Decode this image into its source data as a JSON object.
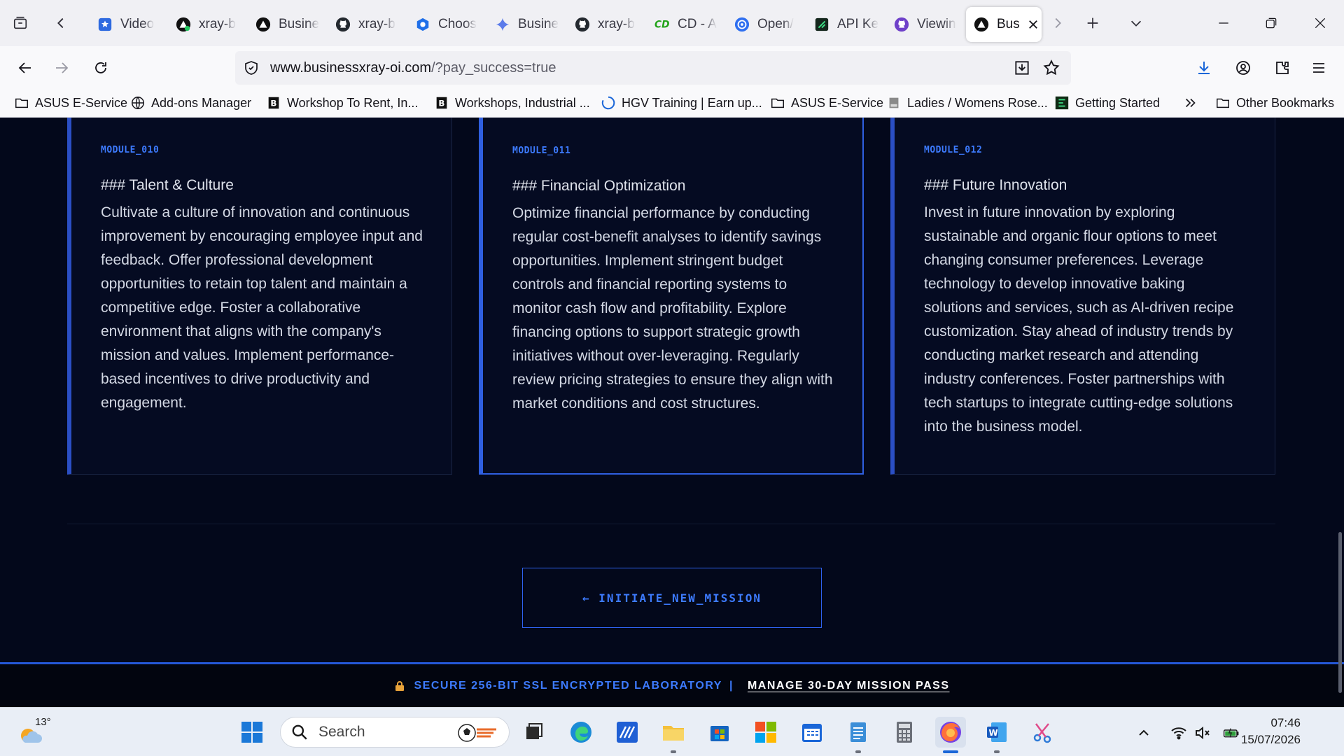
{
  "browser": {
    "tabs": [
      {
        "label": "Video",
        "icon": "gear-star-icon",
        "active": false
      },
      {
        "label": "xray-b",
        "icon": "triangle-logo-icon",
        "active": false
      },
      {
        "label": "Busine",
        "icon": "triangle-logo-icon",
        "active": false
      },
      {
        "label": "xray-b",
        "icon": "github-icon",
        "active": false
      },
      {
        "label": "Choos",
        "icon": "hexagon-icon",
        "active": false
      },
      {
        "label": "Busine",
        "icon": "sparkle-icon",
        "active": false
      },
      {
        "label": "xray-b",
        "icon": "github-icon",
        "active": false
      },
      {
        "label": "CD - A",
        "icon": "cd-logo-icon",
        "active": false
      },
      {
        "label": "Open/",
        "icon": "openai-icon",
        "active": false
      },
      {
        "label": "API Ke",
        "icon": "api-key-icon",
        "active": false
      },
      {
        "label": "Viewin",
        "icon": "github-purple-icon",
        "active": false
      },
      {
        "label": "Bus",
        "icon": "triangle-logo-icon",
        "active": true
      }
    ],
    "url_host": "www.businessxray-oi.com",
    "url_path": "/?pay_success=true",
    "bookmarks": [
      {
        "label": "ASUS E-Service",
        "icon": "folder-icon"
      },
      {
        "label": "Add-ons Manager",
        "icon": "globe-icon"
      },
      {
        "label": "Workshop To Rent, In...",
        "icon": "b-logo-icon"
      },
      {
        "label": "Workshops, Industrial ...",
        "icon": "b-logo-icon"
      },
      {
        "label": "HGV Training | Earn up...",
        "icon": "loading-ring-icon"
      },
      {
        "label": "ASUS E-Service",
        "icon": "folder-icon"
      },
      {
        "label": "Ladies / Womens Rose...",
        "icon": "shoe-icon"
      },
      {
        "label": "Getting Started",
        "icon": "green-logo-icon"
      },
      {
        "label": "Other Bookmarks",
        "icon": "folder-icon"
      }
    ]
  },
  "page": {
    "cards": [
      {
        "module": "MODULE_010",
        "title": "### Talent & Culture",
        "body": "Cultivate a culture of innovation and continuous improvement by encouraging employee input and feedback. Offer professional development opportunities to retain top talent and maintain a competitive edge. Foster a collaborative environment that aligns with the company's mission and values. Implement performance-based incentives to drive productivity and engagement."
      },
      {
        "module": "MODULE_011",
        "title": "### Financial Optimization",
        "body": "Optimize financial performance by conducting regular cost-benefit analyses to identify savings opportunities. Implement stringent budget controls and financial reporting systems to monitor cash flow and profitability. Explore financing options to support strategic growth initiatives without over-leveraging. Regularly review pricing strategies to ensure they align with market conditions and cost structures."
      },
      {
        "module": "MODULE_012",
        "title": "### Future Innovation",
        "body": "Invest in future innovation by exploring sustainable and organic flour options to meet changing consumer preferences. Leverage technology to develop innovative baking solutions and services, such as AI-driven recipe customization. Stay ahead of industry trends by conducting market research and attending industry conferences. Foster partnerships with tech startups to integrate cutting-edge solutions into the business model."
      }
    ],
    "mission_button": "← INITIATE_NEW_MISSION",
    "footer": {
      "secure_text": "SECURE 256-BIT SSL ENCRYPTED LABORATORY",
      "separator": "|",
      "manage_link": "MANAGE 30-DAY MISSION PASS"
    }
  },
  "taskbar": {
    "weather_temp": "13°",
    "search_placeholder": "Search",
    "time": "07:46",
    "date": "15/07/2026"
  },
  "colors": {
    "page_bg": "#03081b",
    "accent": "#3d7bff",
    "card_border_accent": "#2b4fc4"
  }
}
